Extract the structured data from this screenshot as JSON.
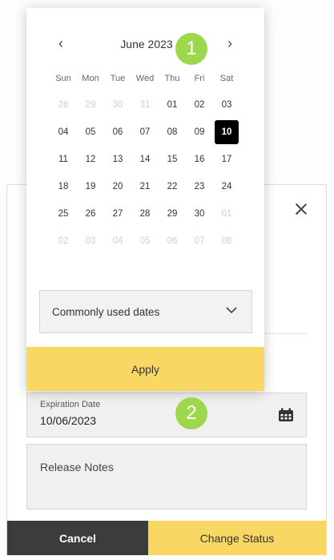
{
  "calendar": {
    "month_title": "June 2023",
    "prev_icon": "chevron-left-icon",
    "next_icon": "chevron-right-icon",
    "weekdays": [
      "Sun",
      "Mon",
      "Tue",
      "Wed",
      "Thu",
      "Fri",
      "Sat"
    ],
    "weeks": [
      [
        {
          "d": "28",
          "m": true
        },
        {
          "d": "29",
          "m": true
        },
        {
          "d": "30",
          "m": true
        },
        {
          "d": "31",
          "m": true
        },
        {
          "d": "01"
        },
        {
          "d": "02"
        },
        {
          "d": "03"
        }
      ],
      [
        {
          "d": "04"
        },
        {
          "d": "05"
        },
        {
          "d": "06"
        },
        {
          "d": "07"
        },
        {
          "d": "08"
        },
        {
          "d": "09"
        },
        {
          "d": "10",
          "s": true
        }
      ],
      [
        {
          "d": "11"
        },
        {
          "d": "12"
        },
        {
          "d": "13"
        },
        {
          "d": "14"
        },
        {
          "d": "15"
        },
        {
          "d": "16"
        },
        {
          "d": "17"
        }
      ],
      [
        {
          "d": "18"
        },
        {
          "d": "19"
        },
        {
          "d": "20"
        },
        {
          "d": "21"
        },
        {
          "d": "22"
        },
        {
          "d": "23"
        },
        {
          "d": "24"
        }
      ],
      [
        {
          "d": "25"
        },
        {
          "d": "26"
        },
        {
          "d": "27"
        },
        {
          "d": "28"
        },
        {
          "d": "29"
        },
        {
          "d": "30"
        },
        {
          "d": "01",
          "m": true
        }
      ],
      [
        {
          "d": "02",
          "m": true
        },
        {
          "d": "03",
          "m": true
        },
        {
          "d": "04",
          "m": true
        },
        {
          "d": "05",
          "m": true
        },
        {
          "d": "06",
          "m": true
        },
        {
          "d": "07",
          "m": true
        },
        {
          "d": "08",
          "m": true
        }
      ]
    ],
    "dropdown_label": "Commonly used dates",
    "apply_label": "Apply"
  },
  "form": {
    "expiration_label": "Expiration Date",
    "expiration_value": "10/06/2023",
    "calendar_icon": "calendar-icon",
    "release_notes_label": "Release Notes"
  },
  "buttons": {
    "cancel": "Cancel",
    "change_status": "Change Status"
  },
  "annotations": {
    "marker1": "1",
    "marker2": "2"
  },
  "colors": {
    "accent": "#f8d862",
    "dark": "#3e3c3a",
    "selected_day": "#000000",
    "marker": "#9dd84c"
  }
}
